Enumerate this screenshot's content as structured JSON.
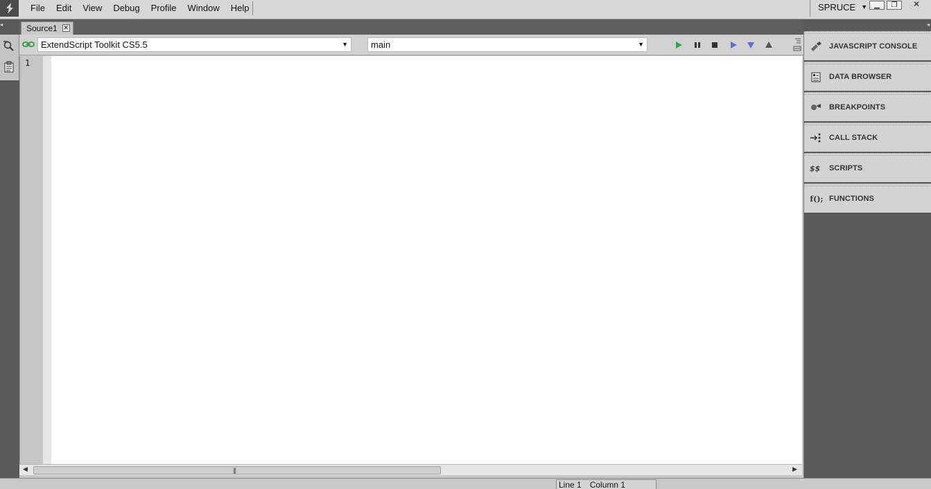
{
  "menubar": {
    "items": [
      "File",
      "Edit",
      "View",
      "Debug",
      "Profile",
      "Window",
      "Help"
    ],
    "workspace": "SPRUCE"
  },
  "document": {
    "tab_label": "Source1",
    "target_app": "ExtendScript Toolkit CS5.5",
    "engine": "main",
    "line_number": "1"
  },
  "debug_toolbar": [
    "play-icon",
    "pause-icon",
    "stop-icon",
    "step-over-icon",
    "step-into-icon",
    "step-out-icon"
  ],
  "panels": [
    {
      "label": "JAVASCRIPT CONSOLE",
      "icon": "console-icon"
    },
    {
      "label": "DATA BROWSER",
      "icon": "data-browser-icon"
    },
    {
      "label": "BREAKPOINTS",
      "icon": "breakpoints-icon"
    },
    {
      "label": "CALL STACK",
      "icon": "call-stack-icon"
    },
    {
      "label": "SCRIPTS",
      "icon": "scripts-icon"
    },
    {
      "label": "FUNCTIONS",
      "icon": "functions-icon",
      "icon_text": "f();"
    }
  ],
  "statusbar": {
    "line": "Line 1",
    "column": "Column 1"
  }
}
